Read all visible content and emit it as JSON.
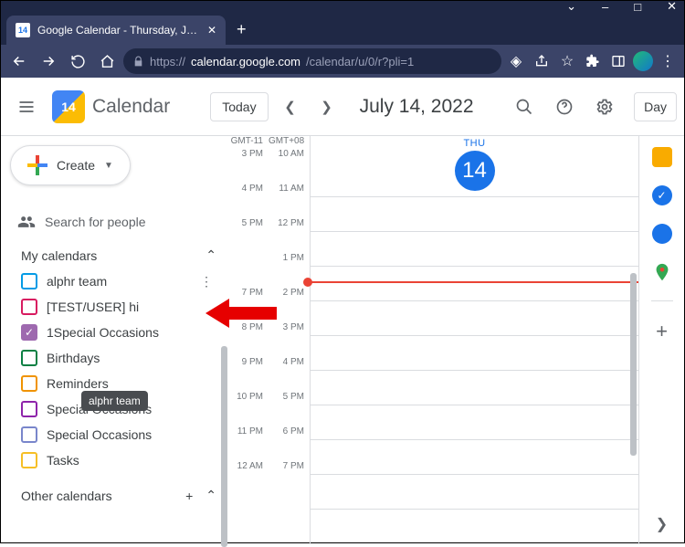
{
  "window": {
    "minimize": "–",
    "maximize": "□",
    "close": "✕",
    "chevron": "⌄"
  },
  "tab": {
    "title": "Google Calendar - Thursday, July",
    "favicon_num": "14",
    "close": "✕"
  },
  "url": {
    "protocol": "https://",
    "host": "calendar.google.com",
    "path": "/calendar/u/0/r?pli=1"
  },
  "header": {
    "app_title": "Calendar",
    "logo_num": "14",
    "today": "Today",
    "date": "July 14, 2022",
    "view": "Day"
  },
  "sidebar": {
    "create": "Create",
    "search_placeholder": "Search for people",
    "my_calendars": "My calendars",
    "other_calendars": "Other calendars",
    "items": [
      {
        "label": "alphr team",
        "color": "#039be5",
        "checked": false,
        "show_dots": true
      },
      {
        "label": "[TEST/USER] hi",
        "color": "#d81b60",
        "checked": false
      },
      {
        "label": "1Special Occasions",
        "color": "#9e69af",
        "checked": true
      },
      {
        "label": "Birthdays",
        "color": "#0b8043",
        "checked": false
      },
      {
        "label": "Reminders",
        "color": "#f09300",
        "checked": false
      },
      {
        "label": "Special Occasions",
        "color": "#8e24aa",
        "checked": false
      },
      {
        "label": "Special Occasions",
        "color": "#7986cb",
        "checked": false
      },
      {
        "label": "Tasks",
        "color": "#f6bf26",
        "checked": false
      }
    ],
    "tooltip": "alphr team"
  },
  "grid": {
    "tz1": "GMT-11",
    "tz2": "GMT+08",
    "col1": [
      "3 PM",
      "4 PM",
      "5 PM",
      "",
      "7 PM",
      "8 PM",
      "9 PM",
      "10 PM",
      "11 PM",
      "12 AM"
    ],
    "col2": [
      "10 AM",
      "11 AM",
      "12 PM",
      "1 PM",
      "2 PM",
      "3 PM",
      "4 PM",
      "5 PM",
      "6 PM",
      "7 PM"
    ],
    "day_name": "THU",
    "day_num": "14"
  },
  "right_panel": {
    "keep": "#f9ab00",
    "tasks": "#1a73e8",
    "contacts": "#1a73e8",
    "maps": "#34a853"
  }
}
